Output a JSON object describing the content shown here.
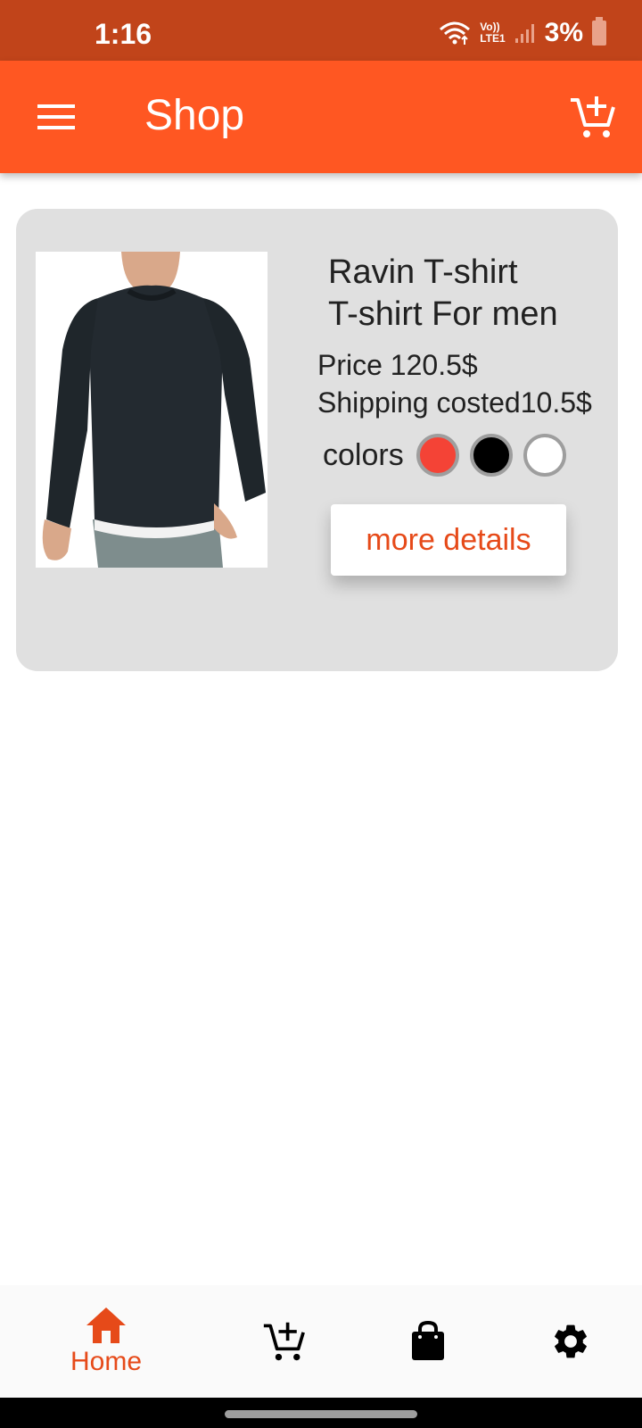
{
  "status_bar": {
    "time": "1:16",
    "volte_top": "Vo))",
    "volte_bottom": "LTE1",
    "battery": "3%"
  },
  "app_bar": {
    "title": "Shop",
    "menu_icon": "menu-icon",
    "cart_icon": "add-shopping-cart-icon"
  },
  "product": {
    "name": "Ravin T-shirt\nT-shirt For men",
    "price": "Price 120.5$",
    "shipping": "Shipping costed10.5$",
    "colors_label": "colors",
    "colors": [
      "#F44336",
      "#000000",
      "#FFFFFF"
    ],
    "details_button": "more details"
  },
  "bottom_nav": {
    "items": [
      {
        "icon": "home-icon",
        "label": "Home",
        "active": true
      },
      {
        "icon": "add-shopping-cart-icon",
        "label": "",
        "active": false
      },
      {
        "icon": "shopping-bag-icon",
        "label": "",
        "active": false
      },
      {
        "icon": "settings-gear-icon",
        "label": "",
        "active": false
      }
    ]
  },
  "theme": {
    "status_bar": "#C1441A",
    "primary": "#FF5722",
    "accent_text": "#E64A19",
    "card_bg": "#E0E0E0"
  }
}
